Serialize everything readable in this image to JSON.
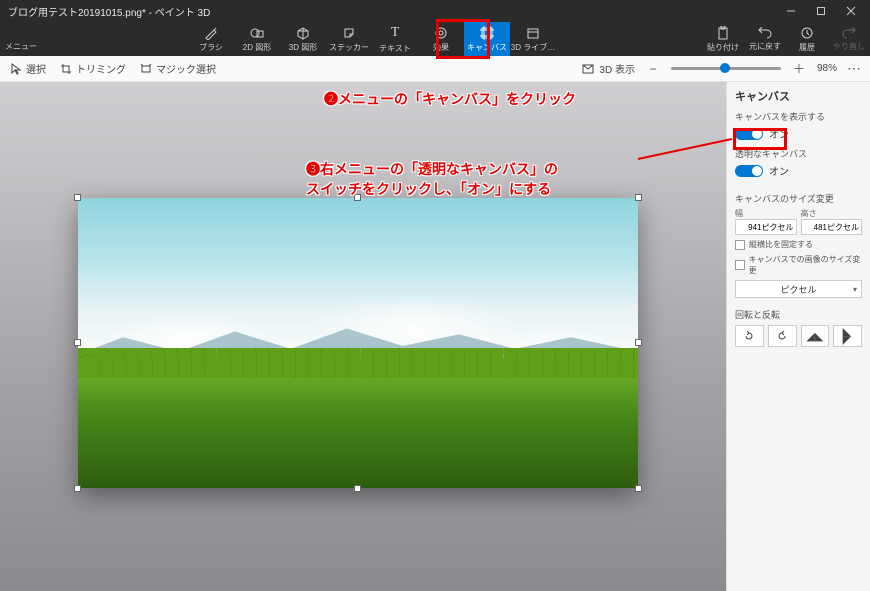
{
  "titlebar": {
    "title": "ブログ用テスト20191015.png* - ペイント 3D"
  },
  "ribbon": {
    "menu": "メニュー",
    "tools": [
      {
        "id": "brushes",
        "label": "ブラシ"
      },
      {
        "id": "shapes2d",
        "label": "2D 図形"
      },
      {
        "id": "shapes3d",
        "label": "3D 図形"
      },
      {
        "id": "stickers",
        "label": "ステッカー"
      },
      {
        "id": "text",
        "label": "テキスト"
      },
      {
        "id": "effects",
        "label": "効果"
      },
      {
        "id": "canvas",
        "label": "キャンバス"
      },
      {
        "id": "library",
        "label": "3D ライブ…"
      }
    ],
    "right": [
      {
        "id": "paste",
        "label": "貼り付け"
      },
      {
        "id": "undo",
        "label": "元に戻す"
      },
      {
        "id": "history",
        "label": "履歴"
      },
      {
        "id": "redo",
        "label": "やり直し"
      }
    ]
  },
  "toolbar2": {
    "select": "選択",
    "trimming": "トリミング",
    "magic": "マジック選択",
    "view3d": "3D 表示",
    "zoom": "98%"
  },
  "panel": {
    "title": "キャンバス",
    "show_label": "キャンバスを表示する",
    "show_state": "オン",
    "transparent_label": "透明なキャンバス",
    "transparent_state": "オン",
    "resize_title": "キャンバスのサイズ変更",
    "width_label": "幅",
    "height_label": "高さ",
    "width_value": "941ピクセル",
    "height_value": "481ピクセル",
    "lock_aspect": "縦横比を固定する",
    "resize_image": "キャンバスでの画像のサイズ変更",
    "unit": "ピクセル",
    "rotate_title": "回転と反転"
  },
  "annotations": {
    "a2": "❷メニューの「キャンバス」をクリック",
    "a3_l1": "❸右メニューの「透明なキャンバス」の",
    "a3_l2": "スイッチをクリックし、「オン」にする"
  }
}
